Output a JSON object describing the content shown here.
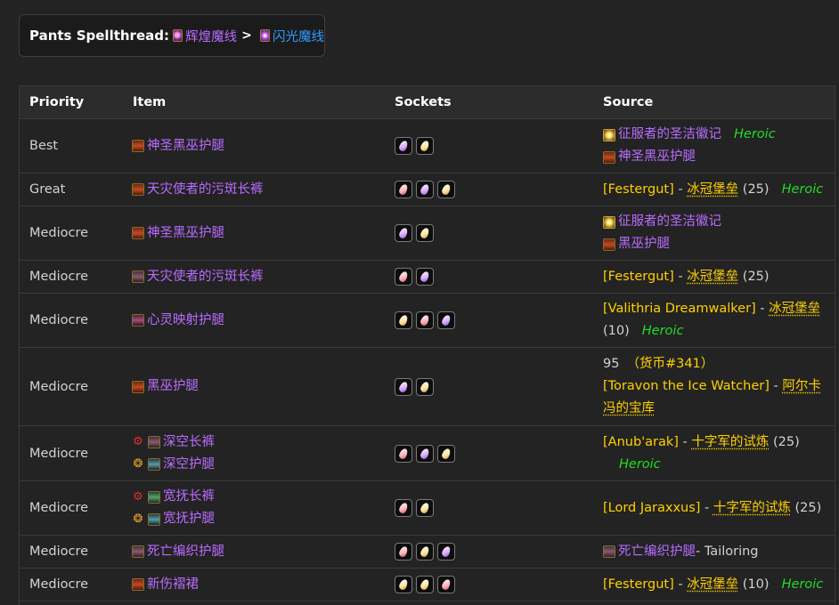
{
  "header": {
    "label": "Pants Spellthread:",
    "from_name": "辉煌魔线",
    "sep": ">",
    "to_name": "闪光魔线"
  },
  "columns": [
    "Priority",
    "Item",
    "Sockets",
    "Source"
  ],
  "heroic_label": "Heroic",
  "rows": [
    {
      "priority": "Best",
      "items": [
        {
          "name": "神圣黑巫护腿",
          "icon": "pants-brown-icon"
        }
      ],
      "sockets": [
        "meta",
        "yellow"
      ],
      "source": [
        {
          "kind": "item",
          "icon": "token-icon",
          "name": "征服者的圣洁徽记",
          "heroic": true
        },
        {
          "kind": "item",
          "icon": "pants-brown-icon",
          "name": "神圣黑巫护腿"
        }
      ]
    },
    {
      "priority": "Great",
      "items": [
        {
          "name": "天灾使者的污斑长裤",
          "icon": "pants-brown-icon"
        }
      ],
      "sockets": [
        "pink",
        "meta",
        "yellow"
      ],
      "source": [
        {
          "kind": "drop",
          "boss": "[Festergut]",
          "dash": " - ",
          "zone": "冰冠堡垒",
          "size": "(25)",
          "heroic": true
        }
      ]
    },
    {
      "priority": "Mediocre",
      "items": [
        {
          "name": "神圣黑巫护腿",
          "icon": "pants-brown-icon"
        }
      ],
      "sockets": [
        "meta",
        "yellow"
      ],
      "source": [
        {
          "kind": "item",
          "icon": "token-icon",
          "name": "征服者的圣洁徽记"
        },
        {
          "kind": "item",
          "icon": "pants-brown-icon",
          "name": "黑巫护腿"
        }
      ]
    },
    {
      "priority": "Mediocre",
      "items": [
        {
          "name": "天灾使者的污斑长裤",
          "icon": "pants-dark-icon"
        }
      ],
      "sockets": [
        "pink",
        "meta"
      ],
      "source": [
        {
          "kind": "drop",
          "boss": "[Festergut]",
          "dash": " - ",
          "zone": "冰冠堡垒",
          "size": "(25)"
        }
      ]
    },
    {
      "priority": "Mediocre",
      "items": [
        {
          "name": "心灵映射护腿",
          "icon": "pants-purple-icon"
        }
      ],
      "sockets": [
        "yellow",
        "pink",
        "meta"
      ],
      "source": [
        {
          "kind": "drop2",
          "boss": "[Valithria Dreamwalker]",
          "dash": " - ",
          "zone": "冰冠堡垒",
          "size": "(10)",
          "heroic": true
        }
      ]
    },
    {
      "priority": "Mediocre",
      "items": [
        {
          "name": "黑巫护腿",
          "icon": "pants-brown-icon"
        }
      ],
      "sockets": [
        "meta",
        "yellow"
      ],
      "source": [
        {
          "kind": "vendor",
          "cost": "95",
          "currency": "（货币#341）",
          "boss": "[Toravon the Ice Watcher]",
          "dash": " - ",
          "zone": "阿尔卡",
          "zone2": "冯的宝库"
        }
      ]
    },
    {
      "priority": "Mediocre",
      "items": [
        {
          "name": "深空长裤",
          "icon": "pants-dark-icon",
          "faction": "horde"
        },
        {
          "name": "深空护腿",
          "icon": "pants-teal-icon",
          "faction": "alliance"
        }
      ],
      "sockets": [
        "pink",
        "meta",
        "yellow"
      ],
      "source": [
        {
          "kind": "drop3",
          "boss": "[Anub'arak]",
          "dash": " - ",
          "zone": "十字军的试炼",
          "size": "(25)",
          "heroic": true
        }
      ]
    },
    {
      "priority": "Mediocre",
      "items": [
        {
          "name": "宽抚长裤",
          "icon": "pants-green-icon",
          "faction": "horde"
        },
        {
          "name": "宽抚护腿",
          "icon": "pants-teal-icon",
          "faction": "alliance"
        }
      ],
      "sockets": [
        "pink",
        "yellow"
      ],
      "source": [
        {
          "kind": "drop",
          "boss": "[Lord Jaraxxus]",
          "dash": " - ",
          "zone": "十字军的试炼",
          "size": "(25)"
        }
      ]
    },
    {
      "priority": "Mediocre",
      "items": [
        {
          "name": "死亡编织护腿",
          "icon": "pants-dark-icon"
        }
      ],
      "sockets": [
        "pink",
        "yellow",
        "meta"
      ],
      "source": [
        {
          "kind": "craft",
          "icon": "pants-dark-icon",
          "name": "死亡编织护腿",
          "profession": " - Tailoring"
        }
      ]
    },
    {
      "priority": "Mediocre",
      "items": [
        {
          "name": "新伤褶裙",
          "icon": "pants-brown-icon"
        }
      ],
      "sockets": [
        "yellow",
        "yellow",
        "pink"
      ],
      "source": [
        {
          "kind": "drop",
          "boss": "[Festergut]",
          "dash": " - ",
          "zone": "冰冠堡垒",
          "size": "(10)",
          "heroic": true
        }
      ]
    }
  ]
}
